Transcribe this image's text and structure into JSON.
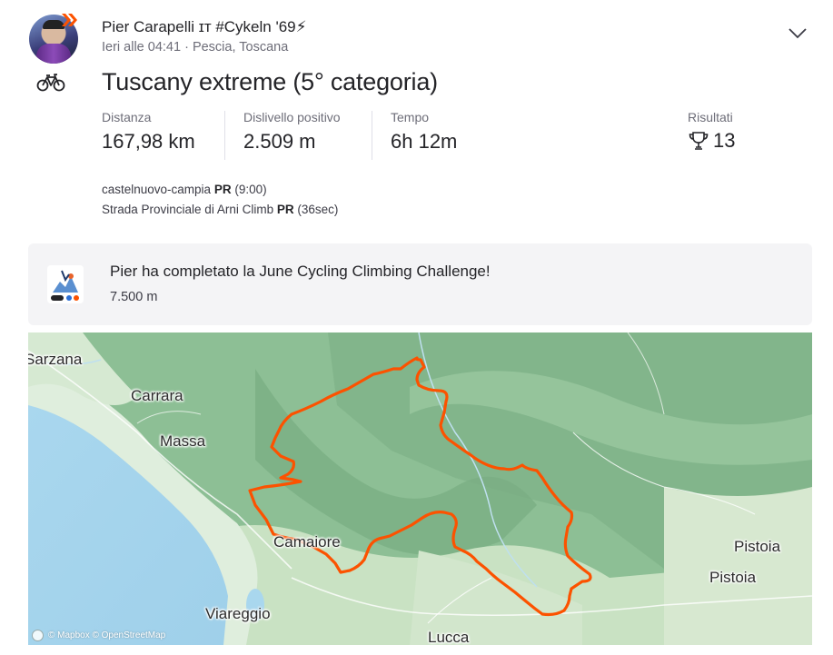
{
  "athlete": {
    "name": "Pier Carapelli ɪᴛ #Cykeln '69⚡",
    "meta": "Ieri alle 04:41 · Pescia, Toscana"
  },
  "activity": {
    "sport": "bike-icon",
    "title": "Tuscany extreme (5° categoria)"
  },
  "stats": [
    {
      "label": "Distanza",
      "value": "167,98 km"
    },
    {
      "label": "Dislivello positivo",
      "value": "2.509 m"
    },
    {
      "label": "Tempo",
      "value": "6h 12m"
    }
  ],
  "results": {
    "label": "Risultati",
    "value": "13",
    "icon": "trophy-icon"
  },
  "segments": [
    {
      "name": "castelnuovo-campia",
      "badge": "PR",
      "detail": "(9:00)"
    },
    {
      "name": "Strada Provinciale di Arni Climb",
      "badge": "PR",
      "detail": "(36sec)"
    }
  ],
  "challenge": {
    "title": "Pier ha completato la June Cycling Climbing Challenge!",
    "value": "7.500 m"
  },
  "map": {
    "route_color": "#fc5200",
    "places": [
      "Sarzana",
      "Carrara",
      "Massa",
      "Camaiore",
      "Viareggio",
      "Lucca",
      "Pistoia",
      "Pistoia"
    ],
    "attribution": "© Mapbox © OpenStreetMap"
  },
  "colors": {
    "brand": "#fc5200",
    "text": "#242428",
    "muted": "#6d6d78"
  }
}
